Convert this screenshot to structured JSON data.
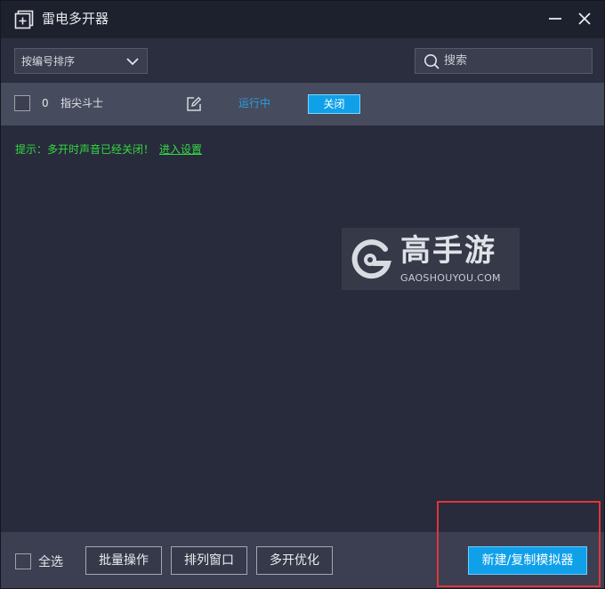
{
  "window": {
    "title": "雷电多开器"
  },
  "toolbar": {
    "sort_selected": "按编号排序",
    "search_placeholder": "搜索"
  },
  "instances": [
    {
      "index": "0",
      "name": "指尖斗士",
      "status": "运行中",
      "action_label": "关闭"
    }
  ],
  "hint": {
    "text": "提示：多开时声音已经关闭！",
    "link": "进入设置"
  },
  "watermark": {
    "title": "高手游",
    "subtitle": "GAOSHOUYOU.COM"
  },
  "bottom": {
    "select_all": "全选",
    "batch": "批量操作",
    "arrange": "排列窗口",
    "optimize": "多开优化",
    "new_copy": "新建/复制模拟器"
  },
  "colors": {
    "accent": "#10a0ea",
    "status_running": "#2b9de4",
    "hint_green": "#35d843",
    "highlight_red": "#e2353a"
  },
  "icons": {
    "app": "add-square-icon",
    "minimize": "minimize-icon",
    "close": "close-icon",
    "sort": "chevron-down-icon",
    "search": "search-icon",
    "edit": "edit-icon"
  }
}
